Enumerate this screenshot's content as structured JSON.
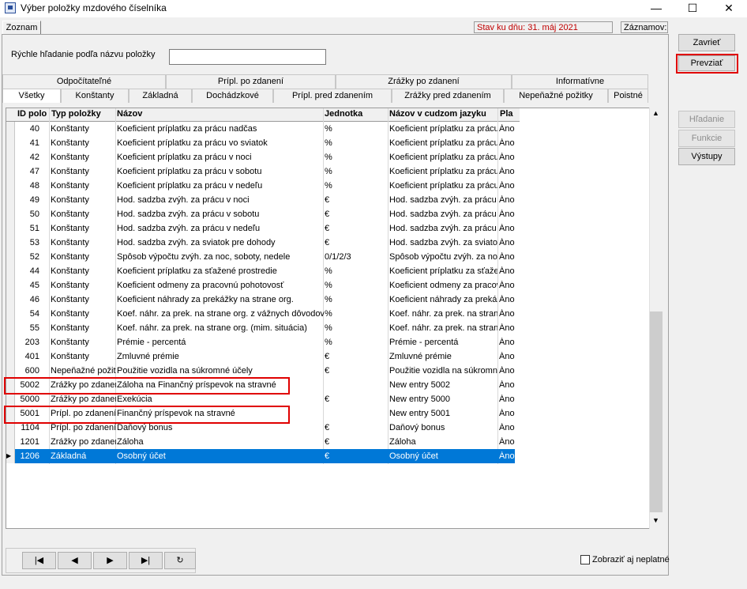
{
  "window": {
    "title": "Výber položky mzdového číselníka",
    "minimize": "—",
    "maximize": "☐",
    "close": "✕"
  },
  "tab": "Zoznam",
  "stav": "Stav ku dňu: 31. máj 2021",
  "zaznamov": "Záznamov:",
  "search": {
    "label": "Rýchle hľadanie podľa názvu položky",
    "value": ""
  },
  "tabs_row1": [
    "Odpočítateľné",
    "Prípl. po zdanení",
    "Zrážky po zdanení",
    "Informatívne"
  ],
  "tabs_row2": [
    "Všetky",
    "Konštanty",
    "Základná",
    "Dochádzkové",
    "Prípl. pred zdanením",
    "Zrážky pred zdanením",
    "Nepeňažné požitky",
    "Poistné"
  ],
  "columns": [
    "ID polo",
    "Typ položky",
    "Názov",
    "Jednotka",
    "Názov v cudzom jazyku",
    "Pla"
  ],
  "rows": [
    {
      "id": "40",
      "typ": "Konštanty",
      "nazov": "Koeficient príplatku za prácu nadčas",
      "jed": "%",
      "cudzi": "Koeficient príplatku za prácu",
      "pla": "Áno"
    },
    {
      "id": "41",
      "typ": "Konštanty",
      "nazov": "Koeficient príplatku za prácu vo sviatok",
      "jed": "%",
      "cudzi": "Koeficient príplatku za prácu",
      "pla": "Áno"
    },
    {
      "id": "42",
      "typ": "Konštanty",
      "nazov": "Koeficient príplatku za prácu v noci",
      "jed": "%",
      "cudzi": "Koeficient príplatku za prácu",
      "pla": "Áno"
    },
    {
      "id": "47",
      "typ": "Konštanty",
      "nazov": "Koeficient príplatku za prácu v sobotu",
      "jed": "%",
      "cudzi": "Koeficient príplatku za prácu",
      "pla": "Áno"
    },
    {
      "id": "48",
      "typ": "Konštanty",
      "nazov": "Koeficient príplatku za prácu v nedeľu",
      "jed": "%",
      "cudzi": "Koeficient príplatku za prácu",
      "pla": "Áno"
    },
    {
      "id": "49",
      "typ": "Konštanty",
      "nazov": "Hod. sadzba zvýh. za prácu v noci",
      "jed": "€",
      "cudzi": "Hod. sadzba zvýh. za prácu v",
      "pla": "Áno"
    },
    {
      "id": "50",
      "typ": "Konštanty",
      "nazov": "Hod. sadzba zvýh. za prácu v sobotu",
      "jed": "€",
      "cudzi": "Hod. sadzba zvýh. za prácu v",
      "pla": "Áno"
    },
    {
      "id": "51",
      "typ": "Konštanty",
      "nazov": "Hod. sadzba zvýh. za prácu v nedeľu",
      "jed": "€",
      "cudzi": "Hod. sadzba zvýh. za prácu v",
      "pla": "Áno"
    },
    {
      "id": "53",
      "typ": "Konštanty",
      "nazov": "Hod. sadzba zvýh. za sviatok pre dohody",
      "jed": "€",
      "cudzi": "Hod. sadzba zvýh. za sviatok",
      "pla": "Áno"
    },
    {
      "id": "52",
      "typ": "Konštanty",
      "nazov": "Spôsob výpočtu zvýh. za noc, soboty, nedele",
      "jed": "0/1/2/3",
      "cudzi": "Spôsob výpočtu zvýh. za noc",
      "pla": "Áno"
    },
    {
      "id": "44",
      "typ": "Konštanty",
      "nazov": "Koeficient príplatku za sťažené prostredie",
      "jed": "%",
      "cudzi": "Koeficient príplatku za sťažen",
      "pla": "Áno"
    },
    {
      "id": "45",
      "typ": "Konštanty",
      "nazov": "Koeficient odmeny za pracovnú pohotovosť",
      "jed": "%",
      "cudzi": "Koeficient odmeny za pracov",
      "pla": "Áno"
    },
    {
      "id": "46",
      "typ": "Konštanty",
      "nazov": "Koeficient náhrady za prekážky na strane org.",
      "jed": "%",
      "cudzi": "Koeficient náhrady za prekáž",
      "pla": "Áno"
    },
    {
      "id": "54",
      "typ": "Konštanty",
      "nazov": "Koef. náhr. za prek. na strane org. z vážnych dôvodov",
      "jed": "%",
      "cudzi": "Koef. náhr. za prek. na strane",
      "pla": "Áno"
    },
    {
      "id": "55",
      "typ": "Konštanty",
      "nazov": "Koef. náhr. za prek. na strane org. (mim. situácia)",
      "jed": "%",
      "cudzi": "Koef. náhr. za prek. na strane",
      "pla": "Áno"
    },
    {
      "id": "203",
      "typ": "Konštanty",
      "nazov": "Prémie - percentá",
      "jed": "%",
      "cudzi": "Prémie - percentá",
      "pla": "Áno"
    },
    {
      "id": "401",
      "typ": "Konštanty",
      "nazov": "Zmluvné prémie",
      "jed": "€",
      "cudzi": "Zmluvné prémie",
      "pla": "Áno"
    },
    {
      "id": "600",
      "typ": "Nepeňažné požit",
      "nazov": "Použitie vozidla na súkromné účely",
      "jed": "€",
      "cudzi": "Použitie vozidla na súkromné",
      "pla": "Áno"
    },
    {
      "id": "5002",
      "typ": "Zrážky po zdanen",
      "nazov": "Záloha na Finančný príspevok na stravné",
      "jed": "",
      "cudzi": "New entry 5002",
      "pla": "Áno"
    },
    {
      "id": "5000",
      "typ": "Zrážky po zdanen",
      "nazov": "Exekúcia",
      "jed": "€",
      "cudzi": "New entry 5000",
      "pla": "Áno"
    },
    {
      "id": "5001",
      "typ": "Prípl. po zdanení",
      "nazov": "Finančný príspevok na stravné",
      "jed": "",
      "cudzi": "New entry 5001",
      "pla": "Áno"
    },
    {
      "id": "1104",
      "typ": "Prípl. po zdanení",
      "nazov": "Daňový bonus",
      "jed": "€",
      "cudzi": "Daňový bonus",
      "pla": "Áno"
    },
    {
      "id": "1201",
      "typ": "Zrážky po zdanen",
      "nazov": "Záloha",
      "jed": "€",
      "cudzi": "Záloha",
      "pla": "Áno"
    },
    {
      "id": "1206",
      "typ": "Základná",
      "nazov": "Osobný účet",
      "jed": "€",
      "cudzi": "Osobný účet",
      "pla": "Áno"
    }
  ],
  "buttons": {
    "zavriet": "Zavrieť",
    "prevziat": "Prevziať",
    "hladanie": "Hľadanie",
    "funkcie": "Funkcie",
    "vystupy": "Výstupy"
  },
  "nav": {
    "first": "|◀",
    "prev": "◀",
    "next": "▶",
    "last": "▶|",
    "refresh": "↻"
  },
  "show_invalid": "Zobraziť aj neplatné"
}
